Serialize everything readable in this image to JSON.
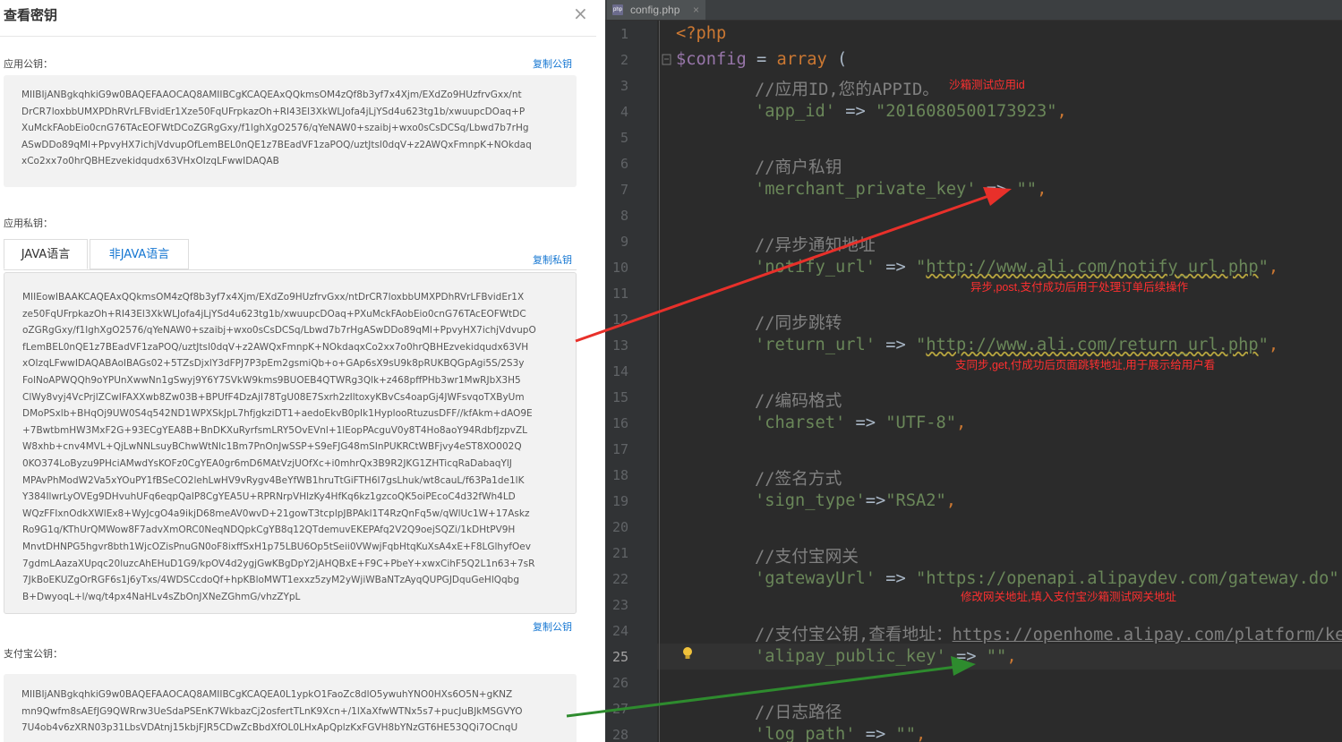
{
  "dialog": {
    "title": "查看密钥",
    "close_glyph": "×",
    "app_public_key_label": "应用公钥：",
    "copy_public_key": "复制公钥",
    "app_public_key_lines": [
      "MIIBIjANBgkqhkiG9w0BAQEFAAOCAQ8AMIIBCgKCAQEAxQQkmsOM4zQf8b3yf7x4Xjm/EXdZo9HUzfrvGxx/nt",
      "DrCR7loxbbUMXPDhRVrLFBvidEr1Xze50FqUFrpkazOh+RI43El3XkWLJofa4jLjYSd4u623tg1b/xwuupcDOaq+P",
      "XuMckFAobEio0cnG76TAcEOFWtDCoZGRgGxy/f1lghXgO2576/qYeNAW0+szaibj+wxo0sCsDCSq/Lbwd7b7rHg",
      "ASwDDo89qMl+PpvyHX7ichjVdvupOfLemBEL0nQE1z7BEadVF1zaPOQ/uztJtsl0dqV+z2AWQxFmnpK+NOkdaq",
      "xCo2xx7o0hrQBHEzvekidqudx63VHxOIzqLFwwIDAQAB"
    ],
    "app_private_key_label": "应用私钥：",
    "tab_java": "JAVA语言",
    "tab_non_java": "非JAVA语言",
    "copy_private_key": "复制私钥",
    "app_private_key_lines": [
      "MIIEowIBAAKCAQEAxQQkmsOM4zQf8b3yf7x4Xjm/EXdZo9HUzfrvGxx/ntDrCR7loxbbUMXPDhRVrLFBvidEr1X",
      "ze50FqUFrpkazOh+RI43El3XkWLJofa4jLjYSd4u623tg1b/xwuupcDOaq+PXuMckFAobEio0cnG76TAcEOFWtDC",
      "oZGRgGxy/f1lghXgO2576/qYeNAW0+szaibj+wxo0sCsDCSq/Lbwd7b7rHgASwDDo89qMl+PpvyHX7ichjVdvupO",
      "fLemBEL0nQE1z7BEadVF1zaPOQ/uztJtsl0dqV+z2AWQxFmnpK+NOkdaqxCo2xx7o0hrQBHEzvekidqudx63VH",
      "xOIzqLFwwIDAQABAoIBAGs02+5TZsDjxlY3dFPJ7P3pEm2gsmiQb+o+GAp6sX9sU9k8pRUKBQGpAgi5S/2S3y",
      "FolNoAPWQQh9oYPUnXwwNn1gSwyj9Y6Y7SVkW9kms9BUOEB4QTWRg3Qlk+z468pffPHb3wr1MwRJbX3H5",
      "ClWy8vyj4VcPrjlZCwIFAXXwb8Zw03B+BPUfF4DzAjI78TgU08E7Sxrh2zIltoxyKBvCs4oapGj4JWFsvqoTXByUm",
      "DMoPSxlb+BHqOj9UW0S4q542ND1WPXSkJpL7hfjgkziDT1+aedoEkvB0pIk1HyplooRtuzusDFF//kfAkm+dAO9E",
      "+7BwtbmHW3MxF2G+93ECgYEA8B+BnDKXuRyrfsmLRY5OvEVnl+1lEopPAcguV0y8T4Ho8aoY94RdbfJzpvZL",
      "W8xhb+cnv4MVL+QjLwNNLsuyBChwWtNlc1Bm7PnOnJwSSP+S9eFJG48mSInPUKRCtWBFjvy4eST8XO002Q",
      "0KO374LoByzu9PHciAMwdYsKOFz0CgYEA0gr6mD6MAtVzjUOfXc+i0mhrQx3B9R2JKG1ZHTicqRaDabaqYlJ",
      "MPAvPhModW2Va5xYOuPY1fBSeCO2lehLwHV9vRygv4BeYfWB1hruTtGiFTH6I7gsLhuk/wt8cauL/f63Pa1de1lK",
      "Y384IlwrLyOVEg9DHvuhUFq6eqpQaIP8CgYEA5U+RPRNrpVHlzKy4HfKq6kz1gzcoQK5oiPEcoC4d32fWh4LD",
      "WQzFFIxnOdkXWlEx8+WyJcgO4a9ikjD68meAV0wvD+21gowT3tcplpJBPAkl1T4RzQnFq5w/qWlUc1W+17Askz",
      "Ro9G1q/KThUrQMWow8F7advXmORC0NeqNDQpkCgYB8q12QTdemuvEKEPAfq2V2Q9oejSQZi/1kDHtPV9H",
      "MnvtDHNPG5hgvr8bth1WjcOZisPnuGN0oF8ixffSxH1p75LBU6Op5tSeii0VWwjFqbHtqKuXsA4xE+F8LGlhyfOev",
      "7gdmLAazaXUpqc20luzcAhEHuD1G9/kpOV4d2ygjGwKBgDpY2jAHQBxE+F9C+PbeY+xwxCihF5Q2L1n63+7sR",
      "7JkBoEKUZgOrRGF6s1j6yTxs/4WDSCcdoQf+hpKBloMWT1exxz5zyM2yWjiWBaNTzAyqQUPGJDquGeHlQqbg",
      "B+DwyoqL+l/wq/t4px4NaHLv4sZbOnJXNeZGhmG/vhzZYpL"
    ],
    "copy_public_key_2": "复制公钥",
    "alipay_public_key_label": "支付宝公钥：",
    "alipay_public_key_lines": [
      "MIIBIjANBgkqhkiG9w0BAQEFAAOCAQ8AMIIBCgKCAQEA0L1ypkO1FaoZc8dlO5ywuhYNO0HXs6O5N+gKNZ",
      "mn9Qwfm8sAEfJG9QWRrw3UeSdaPSEnK7WkbazCj2osfertTLnK9Xcn+/1lXaXfwWTNx5s7+pucJuBJkMSGVYO",
      "7U4ob4v6zXRN03p31LbsVDAtnj15kbjFJR5CDwZcBbdXfOL0LHxApQplzKxFGVH8bYNzGT6HE53QQi7OCnqU"
    ]
  },
  "editor": {
    "file_tab": "config.php",
    "file_icon": "php-file-icon",
    "tab_close": "×",
    "line_numbers": [
      "1",
      "2",
      "3",
      "4",
      "5",
      "6",
      "7",
      "8",
      "9",
      "10",
      "11",
      "12",
      "13",
      "14",
      "15",
      "16",
      "17",
      "18",
      "19",
      "20",
      "21",
      "22",
      "23",
      "24",
      "25",
      "26",
      "27",
      "28"
    ],
    "code": {
      "l1": "<?php",
      "l2_var": "$config",
      "l2_op": " = ",
      "l2_kw": "array",
      "l2_paren": " (",
      "l3": "//应用ID,您的APPID。",
      "l4_key": "'app_id'",
      "l4_arrow": " => ",
      "l4_val": "\"2016080500173923\"",
      "l4_comma": ",",
      "l6": "//商户私钥",
      "l7_key": "'merchant_private_key'",
      "l7_arrow": " => ",
      "l7_val": "\"\"",
      "l7_comma": ",",
      "l9": "//异步通知地址",
      "l10_key": "'notify_url'",
      "l10_arrow": " => ",
      "l10_q1": "\"",
      "l10_url": "http://www.ali.com/notify_url.php",
      "l10_q2": "\"",
      "l10_comma": ",",
      "l12": "//同步跳转",
      "l13_key": "'return_url'",
      "l13_arrow": " => ",
      "l13_q1": "\"",
      "l13_url": "http://www.ali.com/return_url.php",
      "l13_q2": "\"",
      "l13_comma": ",",
      "l15": "//编码格式",
      "l16_key": "'charset'",
      "l16_arrow": " => ",
      "l16_val": "\"UTF-8\"",
      "l16_comma": ",",
      "l18": "//签名方式",
      "l19_key": "'sign_type'",
      "l19_arrow": "=>",
      "l19_val": "\"RSA2\"",
      "l19_comma": ",",
      "l21": "//支付宝网关",
      "l22_key": "'gatewayUrl'",
      "l22_arrow": " => ",
      "l22_val": "\"https://openapi.alipaydev.com/gateway.do\"",
      "l22_comma": ",",
      "l24_comment": "//支付宝公钥,查看地址：",
      "l24_url": "https://openhome.alipay.com/platform/ke",
      "l25_key": "'alipay_public_key'",
      "l25_arrow": " => ",
      "l25_val": "\"\"",
      "l25_comma": ",",
      "l27": "//日志路径",
      "l28_key": "'log_path'",
      "l28_arrow": " => ",
      "l28_val": "\"\"",
      "l28_comma": ","
    },
    "annotations": {
      "appid": "沙箱测试应用id",
      "notify": "异步,post,支付成功后用于处理订单后续操作",
      "return": "支同步,get,付成功后页面跳转地址,用于展示给用户看",
      "gateway": "修改网关地址,填入支付宝沙箱测试网关地址"
    },
    "bulb_icon": "lightbulb-icon"
  },
  "colors": {
    "editor_bg": "#2b2b2b",
    "keyword": "#cc7832",
    "string": "#6a8759",
    "comment": "#808080",
    "annotation": "#ff3030",
    "arrow_red": "#e8302a",
    "arrow_green": "#2e8b2e",
    "link": "#1677d2"
  }
}
